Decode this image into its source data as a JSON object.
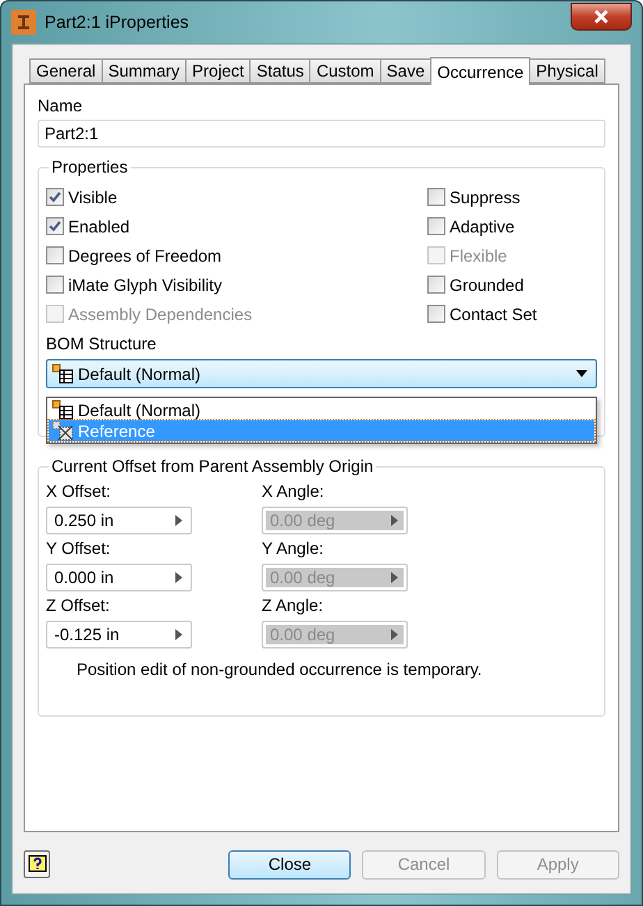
{
  "window": {
    "title": "Part2:1 iProperties"
  },
  "tabs": [
    {
      "label": "General",
      "selected": false
    },
    {
      "label": "Summary",
      "selected": false
    },
    {
      "label": "Project",
      "selected": false
    },
    {
      "label": "Status",
      "selected": false
    },
    {
      "label": "Custom",
      "selected": false
    },
    {
      "label": "Save",
      "selected": false
    },
    {
      "label": "Occurrence",
      "selected": true
    },
    {
      "label": "Physical",
      "selected": false
    }
  ],
  "name": {
    "label": "Name",
    "value": "Part2:1"
  },
  "properties": {
    "title": "Properties",
    "left": [
      {
        "label": "Visible",
        "checked": true,
        "disabled": false
      },
      {
        "label": "Enabled",
        "checked": true,
        "disabled": false
      },
      {
        "label": "Degrees of Freedom",
        "checked": false,
        "disabled": false
      },
      {
        "label": "iMate Glyph Visibility",
        "checked": false,
        "disabled": false
      },
      {
        "label": "Assembly Dependencies",
        "checked": false,
        "disabled": true
      }
    ],
    "right": [
      {
        "label": "Suppress",
        "checked": false,
        "disabled": false
      },
      {
        "label": "Adaptive",
        "checked": false,
        "disabled": false
      },
      {
        "label": "Flexible",
        "checked": false,
        "disabled": true
      },
      {
        "label": "Grounded",
        "checked": false,
        "disabled": false
      },
      {
        "label": "Contact Set",
        "checked": false,
        "disabled": false
      }
    ],
    "bom": {
      "label": "BOM Structure",
      "value": "Default (Normal)",
      "options": [
        {
          "label": "Default (Normal)",
          "kind": "normal",
          "highlighted": false
        },
        {
          "label": "Reference",
          "kind": "reference",
          "highlighted": true
        }
      ]
    }
  },
  "offset": {
    "title": "Current Offset from Parent Assembly Origin",
    "fields": [
      {
        "label": "X Offset:",
        "value": "0.250 in",
        "disabled": false
      },
      {
        "label": "X Angle:",
        "value": "0.00 deg",
        "disabled": true
      },
      {
        "label": "Y Offset:",
        "value": "0.000 in",
        "disabled": false
      },
      {
        "label": "Y Angle:",
        "value": "0.00 deg",
        "disabled": true
      },
      {
        "label": "Z Offset:",
        "value": "-0.125 in",
        "disabled": false
      },
      {
        "label": "Z Angle:",
        "value": "0.00 deg",
        "disabled": true
      }
    ],
    "note": "Position edit of non-grounded occurrence is temporary."
  },
  "buttons": [
    {
      "label": "Close",
      "disabled": false
    },
    {
      "label": "Cancel",
      "disabled": true
    },
    {
      "label": "Apply",
      "disabled": true
    }
  ]
}
